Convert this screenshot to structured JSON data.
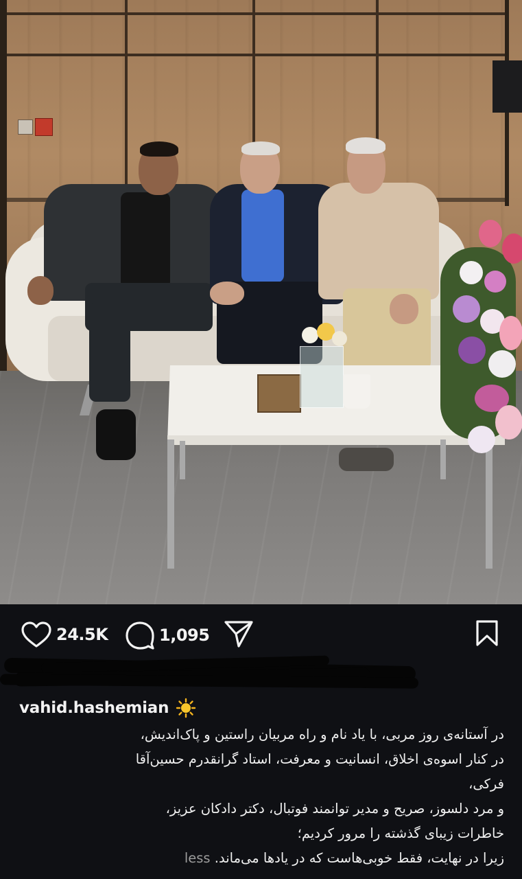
{
  "post": {
    "likes": "24.5K",
    "comments": "1,095",
    "username": "vahid.hashemian",
    "username_badge_icon": "sun-icon",
    "caption_lines": [
      "در آستانه‌ی روز مربی، با یاد نام و راه مربیان راستین و پاک‌اندیش،",
      "در کنار اسوه‌ی اخلاق، انسانیت و معرفت، استاد گرانقدرم حسین‌آقا",
      "فرکی،",
      "و مرد دلسوز، صریح و مدیر توانمند فوتبال، دکتر دادکان عزیز،",
      "خاطرات زیبای گذشته را مرور کردیم؛",
      "زیرا در نهایت، فقط خوبی‌هاست که در یادها می‌ماند."
    ],
    "less_label": "less"
  },
  "icons": {
    "like": "heart-icon",
    "comment": "comment-bubble-icon",
    "share": "send-paper-plane-icon",
    "save": "bookmark-icon"
  },
  "colors": {
    "background": "#0f1014",
    "text": "#f2f2f2",
    "muted": "#9c9c9c"
  }
}
